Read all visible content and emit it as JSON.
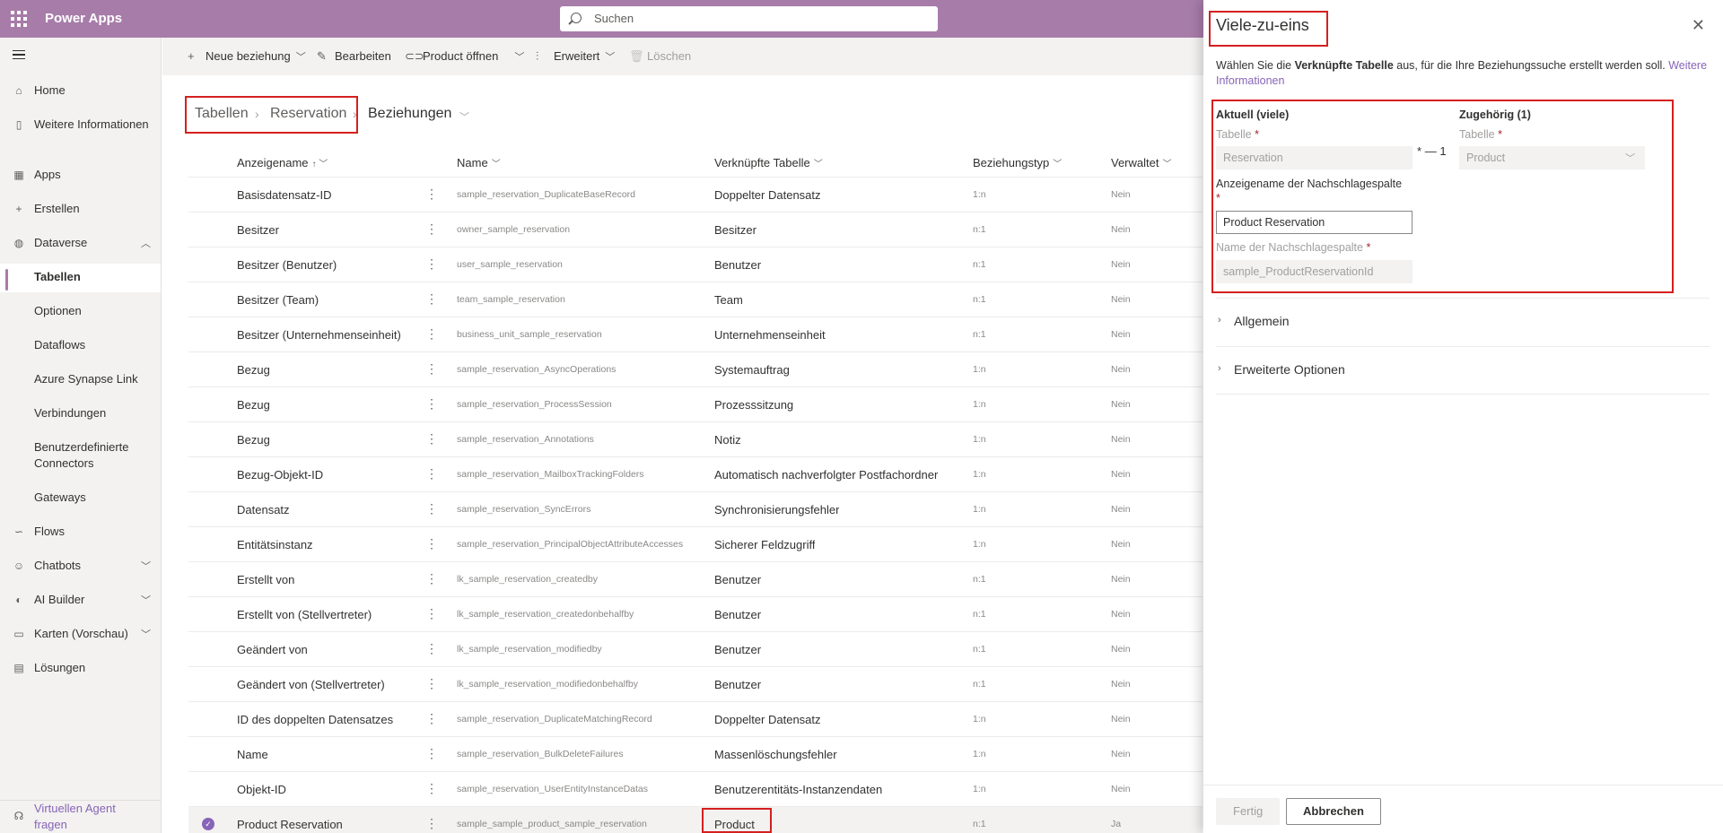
{
  "app": {
    "title": "Power Apps"
  },
  "search": {
    "placeholder": "Suchen"
  },
  "sidebar": {
    "items": [
      {
        "label": "Home"
      },
      {
        "label": "Weitere Informationen"
      },
      {
        "label": "Apps"
      },
      {
        "label": "Erstellen"
      },
      {
        "label": "Dataverse"
      },
      {
        "label": "Tabellen"
      },
      {
        "label": "Optionen"
      },
      {
        "label": "Dataflows"
      },
      {
        "label": "Azure Synapse Link"
      },
      {
        "label": "Verbindungen"
      },
      {
        "label": "Benutzerdefinierte Connectors"
      },
      {
        "label": "Gateways"
      },
      {
        "label": "Flows"
      },
      {
        "label": "Chatbots"
      },
      {
        "label": "AI Builder"
      },
      {
        "label": "Karten (Vorschau)"
      },
      {
        "label": "Lösungen"
      }
    ],
    "agent_label": "Virtuellen Agent fragen"
  },
  "toolbar": {
    "new_relationship": "Neue beziehung",
    "edit": "Bearbeiten",
    "open_product": "Product öffnen",
    "advanced": "Erweitert",
    "delete": "Löschen"
  },
  "breadcrumb": {
    "tables": "Tabellen",
    "entity": "Reservation",
    "current": "Beziehungen"
  },
  "table": {
    "headers": {
      "display_name": "Anzeigename",
      "name": "Name",
      "related_table": "Verknüpfte Tabelle",
      "relationship_type": "Beziehungstyp",
      "managed": "Verwaltet"
    },
    "rows": [
      {
        "display": "Basisdatensatz-ID",
        "name": "sample_reservation_DuplicateBaseRecord",
        "related": "Doppelter Datensatz",
        "type": "1:n",
        "managed": "Nein"
      },
      {
        "display": "Besitzer",
        "name": "owner_sample_reservation",
        "related": "Besitzer",
        "type": "n:1",
        "managed": "Nein"
      },
      {
        "display": "Besitzer (Benutzer)",
        "name": "user_sample_reservation",
        "related": "Benutzer",
        "type": "n:1",
        "managed": "Nein"
      },
      {
        "display": "Besitzer (Team)",
        "name": "team_sample_reservation",
        "related": "Team",
        "type": "n:1",
        "managed": "Nein"
      },
      {
        "display": "Besitzer (Unternehmenseinheit)",
        "name": "business_unit_sample_reservation",
        "related": "Unternehmenseinheit",
        "type": "n:1",
        "managed": "Nein"
      },
      {
        "display": "Bezug",
        "name": "sample_reservation_AsyncOperations",
        "related": "Systemauftrag",
        "type": "1:n",
        "managed": "Nein"
      },
      {
        "display": "Bezug",
        "name": "sample_reservation_ProcessSession",
        "related": "Prozesssitzung",
        "type": "1:n",
        "managed": "Nein"
      },
      {
        "display": "Bezug",
        "name": "sample_reservation_Annotations",
        "related": "Notiz",
        "type": "1:n",
        "managed": "Nein"
      },
      {
        "display": "Bezug-Objekt-ID",
        "name": "sample_reservation_MailboxTrackingFolders",
        "related": "Automatisch nachverfolgter Postfachordner",
        "type": "1:n",
        "managed": "Nein"
      },
      {
        "display": "Datensatz",
        "name": "sample_reservation_SyncErrors",
        "related": "Synchronisierungsfehler",
        "type": "1:n",
        "managed": "Nein"
      },
      {
        "display": "Entitätsinstanz",
        "name": "sample_reservation_PrincipalObjectAttributeAccesses",
        "related": "Sicherer Feldzugriff",
        "type": "1:n",
        "managed": "Nein"
      },
      {
        "display": "Erstellt von",
        "name": "lk_sample_reservation_createdby",
        "related": "Benutzer",
        "type": "n:1",
        "managed": "Nein"
      },
      {
        "display": "Erstellt von (Stellvertreter)",
        "name": "lk_sample_reservation_createdonbehalfby",
        "related": "Benutzer",
        "type": "n:1",
        "managed": "Nein"
      },
      {
        "display": "Geändert von",
        "name": "lk_sample_reservation_modifiedby",
        "related": "Benutzer",
        "type": "n:1",
        "managed": "Nein"
      },
      {
        "display": "Geändert von (Stellvertreter)",
        "name": "lk_sample_reservation_modifiedonbehalfby",
        "related": "Benutzer",
        "type": "n:1",
        "managed": "Nein"
      },
      {
        "display": "ID des doppelten Datensatzes",
        "name": "sample_reservation_DuplicateMatchingRecord",
        "related": "Doppelter Datensatz",
        "type": "1:n",
        "managed": "Nein"
      },
      {
        "display": "Name",
        "name": "sample_reservation_BulkDeleteFailures",
        "related": "Massenlöschungsfehler",
        "type": "1:n",
        "managed": "Nein"
      },
      {
        "display": "Objekt-ID",
        "name": "sample_reservation_UserEntityInstanceDatas",
        "related": "Benutzerentitäts-Instanzendaten",
        "type": "1:n",
        "managed": "Nein"
      },
      {
        "display": "Product Reservation",
        "name": "sample_sample_product_sample_reservation",
        "related": "Product",
        "type": "n:1",
        "managed": "Ja"
      }
    ]
  },
  "panel": {
    "title": "Viele-zu-eins",
    "desc_pre": "Wählen Sie die ",
    "desc_bold": "Verknüpfte Tabelle",
    "desc_post": " aus, für die Ihre Beziehungssuche erstellt werden soll. ",
    "desc_link": "Weitere Informationen",
    "current_heading": "Aktuell (viele)",
    "related_heading": "Zugehörig (1)",
    "table_label": "Tabelle",
    "required_mark": "*",
    "current_table_value": "Reservation",
    "related_table_value": "Product",
    "cardinality_many": "*",
    "cardinality_dash": "—",
    "cardinality_one": "1",
    "lookup_display_label": "Anzeigename der Nachschlagespalte",
    "lookup_display_value": "Product Reservation",
    "lookup_name_label": "Name der Nachschlagespalte",
    "lookup_name_value": "sample_ProductReservationId",
    "general_section": "Allgemein",
    "advanced_section": "Erweiterte Optionen",
    "done_button": "Fertig",
    "cancel_button": "Abbrechen"
  },
  "colors": {
    "brand": "#a77ca9",
    "highlight": "#d61f1f",
    "link": "#8764b8"
  }
}
